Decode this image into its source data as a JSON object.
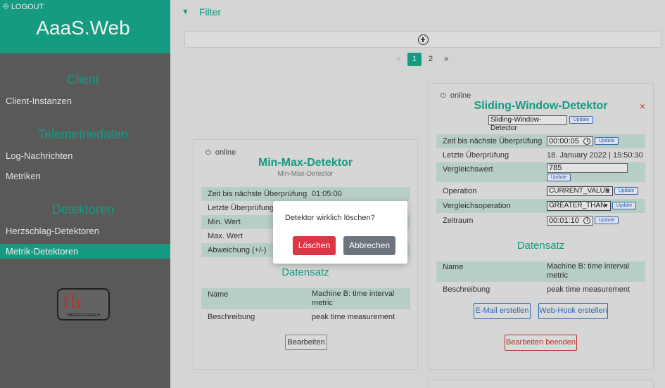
{
  "sidebar": {
    "logout_label": "LOGOUT",
    "app_title": "AaaS.Web",
    "sections": [
      {
        "title": "Client",
        "items": [
          "Client-Instanzen"
        ]
      },
      {
        "title": "Telemetriedaten",
        "items": [
          "Log-Nachrichten",
          "Metriken"
        ]
      },
      {
        "title": "Detektoren",
        "items": [
          "Herzschlag-Detektoren",
          "Metrik-Detektoren"
        ]
      }
    ],
    "active_item": "Metrik-Detektoren",
    "logo_text": "fh",
    "logo_sub": "OBERÖSTERREICH"
  },
  "main": {
    "filter_label": "Filter",
    "pagination": {
      "prev": "«",
      "pages": [
        "1",
        "2"
      ],
      "next": "»",
      "current": "1"
    }
  },
  "card_left": {
    "status": "online",
    "title": "Min-Max-Detektor",
    "subtitle": "Min-Max-Detector",
    "rows": [
      {
        "key": "Zeit bis nächste Überprüfung",
        "value": "01:05:00"
      },
      {
        "key": "Letzte Überprüfung",
        "value": ""
      },
      {
        "key": "Min. Wert",
        "value": ""
      },
      {
        "key": "Max. Wert",
        "value": ""
      },
      {
        "key": "Abweichung (+/-)",
        "value": ""
      }
    ],
    "dataset_title": "Datensatz",
    "dataset_rows": [
      {
        "key": "Name",
        "value": "Machine B: time interval metric"
      },
      {
        "key": "Beschreibung",
        "value": "peak time measurement"
      }
    ],
    "edit_label": "Bearbeiten"
  },
  "card_right": {
    "status": "online",
    "title": "Sliding-Window-Detektor",
    "subtitle_input": "Sliding-Window-Detector",
    "update_label": "Update",
    "close_glyph": "×",
    "rows": [
      {
        "key": "Zeit bis nächste Überprüfung",
        "value": "00:00:05"
      },
      {
        "key": "Letzte Überprüfung",
        "value": "18. January 2022 | 15:50:30"
      },
      {
        "key": "Vergleichswert",
        "value": "785"
      },
      {
        "key": "Operation",
        "value": "CURRENT_VALUE"
      },
      {
        "key": "Vergleichsoperation",
        "value": "GREATER_THAN"
      },
      {
        "key": "Zeitraum",
        "value": "00:01:10"
      }
    ],
    "dataset_title": "Datensatz",
    "dataset_rows": [
      {
        "key": "Name",
        "value": "Machine B: time interval metric"
      },
      {
        "key": "Beschreibung",
        "value": "peak time measurement"
      }
    ],
    "email_label": "E-Mail erstellen",
    "webhook_label": "Web-Hook erstellen",
    "stop_edit_label": "Bearbeiten beenden"
  },
  "modal": {
    "message": "Detektor wirklich löschen?",
    "delete_label": "Löschen",
    "cancel_label": "Abbrechen"
  },
  "colors": {
    "accent": "#17a589",
    "sidebar_bg": "#5f5f5f",
    "danger": "#dc3545",
    "secondary": "#6c757d",
    "row_tint": "#c3dbd2"
  }
}
